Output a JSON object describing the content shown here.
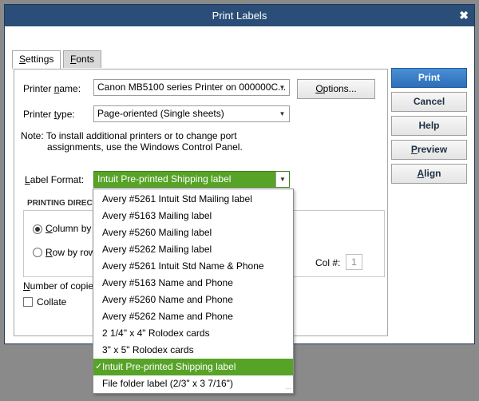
{
  "window": {
    "title": "Print Labels"
  },
  "tabs": [
    {
      "label": "Settings",
      "underline": "S",
      "rest": "ettings"
    },
    {
      "label": "Fonts",
      "underline": "F",
      "rest": "onts"
    }
  ],
  "printer": {
    "name_label_pre": "Printer ",
    "name_label_u": "n",
    "name_label_post": "ame:",
    "name_value": "Canon MB5100 series Printer on 000000C...",
    "type_label_pre": "Printer ",
    "type_label_u": "t",
    "type_label_post": "ype:",
    "type_value": "Page-oriented (Single sheets)",
    "options_pre": "",
    "options_u": "O",
    "options_post": "ptions...",
    "note_line1": "Note: To install additional printers or to change port",
    "note_line2": "assignments, use the Windows Control Panel."
  },
  "label_format": {
    "label_pre": "",
    "label_u": "L",
    "label_post": "abel Format:",
    "value": "Intuit Pre-printed Shipping label"
  },
  "printing_direction": {
    "title": "PRINTING DIRECTI",
    "column_u": "C",
    "column_rest": "olumn by c",
    "row_u": "R",
    "row_rest": "ow by row",
    "col_label": "Col #:",
    "col_value": "1"
  },
  "copies": {
    "label_u": "N",
    "label_rest": "umber of copies",
    "collate_label": "Collate"
  },
  "buttons": {
    "print": "Print",
    "cancel": "Cancel",
    "help": "Help",
    "preview_u": "P",
    "preview_rest": "review",
    "align_u": "A",
    "align_rest": "lign"
  },
  "dropdown": {
    "options": [
      "Avery #5261 Intuit Std Mailing label",
      "Avery #5163 Mailing label",
      "Avery #5260 Mailing label",
      "Avery #5262 Mailing label",
      "Avery #5261 Intuit Std Name & Phone",
      "Avery #5163 Name and Phone",
      "Avery #5260 Name and Phone",
      "Avery #5262 Name and Phone",
      "2 1/4\" x 4\" Rolodex cards",
      "3\" x 5\" Rolodex cards",
      "Intuit Pre-printed Shipping label",
      "File folder label (2/3\" x 3 7/16\")"
    ],
    "selected_index": 10
  },
  "colors": {
    "titlebar": "#2a4e78",
    "selection_green": "#57a327",
    "primary_button": "#2d6fb8",
    "backdrop": "#8a8a8a"
  }
}
